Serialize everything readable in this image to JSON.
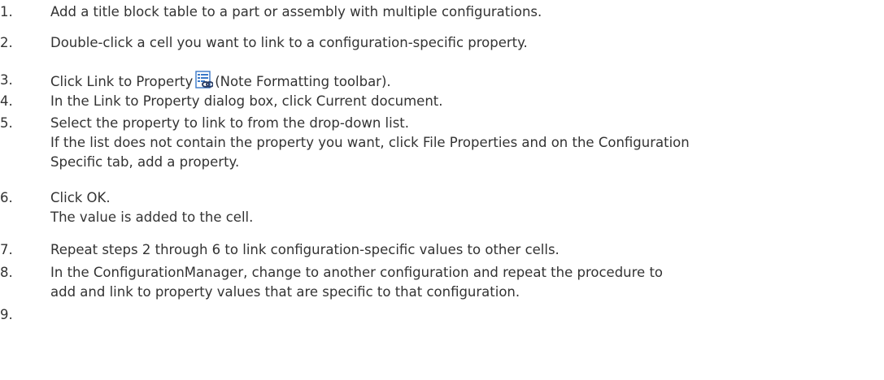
{
  "steps": [
    {
      "num": "1.",
      "lines": [
        "Add a title block table to a part or assembly with multiple configurations."
      ]
    },
    {
      "num": "2.",
      "lines": [
        "Double-click a cell you want to link to a configuration-specific property."
      ]
    },
    {
      "num": "3.",
      "text_before": "Click Link to Property",
      "icon": "link-to-property-icon",
      "text_after": "(Note Formatting toolbar)."
    },
    {
      "num": "4.",
      "lines": [
        "In the Link to Property dialog box, click Current document."
      ]
    },
    {
      "num": "5.",
      "lines": [
        "Select the property to link to from the drop-down list.",
        "If the list does not contain the property you want, click File Properties and on the Configuration",
        "Specific tab, add a property."
      ]
    },
    {
      "num": "6.",
      "lines": [
        "Click OK.",
        "The value is added to the cell."
      ]
    },
    {
      "num": "7.",
      "lines": [
        "Repeat steps 2 through 6 to link configuration-specific values to other cells."
      ]
    },
    {
      "num": "8.",
      "lines": [
        "In the ConfigurationManager, change to another configuration and repeat the procedure to",
        "add and link to property values that are specific to that configuration."
      ]
    },
    {
      "num": "9.",
      "lines": []
    }
  ],
  "colors": {
    "text": "#333333",
    "icon_blue": "#3a78c8",
    "icon_link": "#2b3e66"
  }
}
